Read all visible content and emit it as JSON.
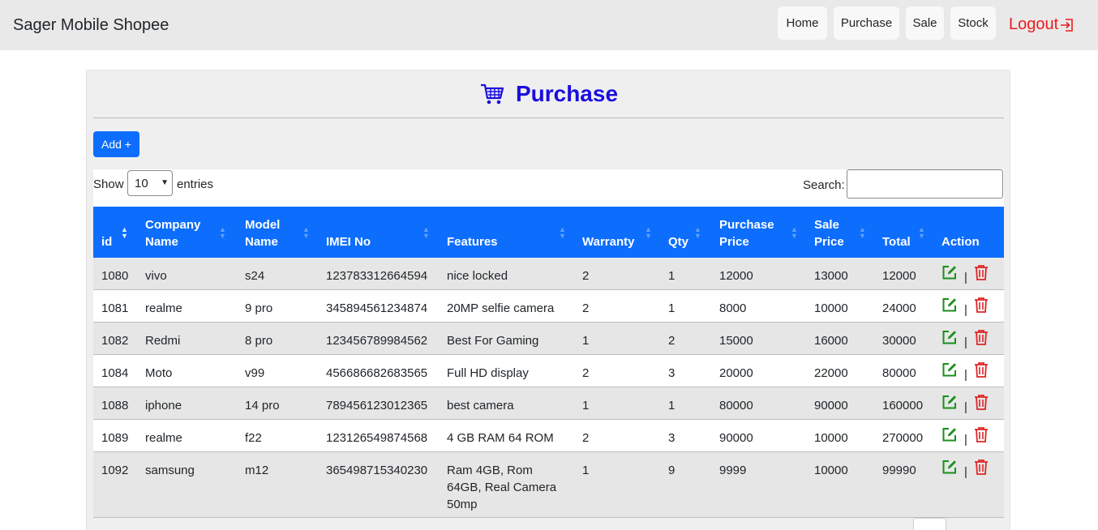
{
  "navbar": {
    "brand": "Sager Mobile Shopee",
    "links": [
      "Home",
      "Purchase",
      "Sale",
      "Stock"
    ],
    "logout": "Logout"
  },
  "page": {
    "title": "Purchase",
    "add_button": "Add +"
  },
  "controls": {
    "show_label": "Show",
    "entries_value": "10",
    "entries_label": "entries",
    "search_label": "Search:",
    "search_value": ""
  },
  "table": {
    "headers": [
      {
        "line1": "id",
        "line2": ""
      },
      {
        "line1": "Company",
        "line2": "Name"
      },
      {
        "line1": "Model",
        "line2": "Name"
      },
      {
        "line1": "IMEI No",
        "line2": ""
      },
      {
        "line1": "Features",
        "line2": ""
      },
      {
        "line1": "Warranty",
        "line2": ""
      },
      {
        "line1": "Qty",
        "line2": ""
      },
      {
        "line1": "Purchase",
        "line2": "Price"
      },
      {
        "line1": "Sale",
        "line2": "Price"
      },
      {
        "line1": "Total",
        "line2": ""
      },
      {
        "line1": "Action",
        "line2": ""
      }
    ],
    "rows": [
      [
        "1080",
        "vivo",
        "s24",
        "123783312664594",
        "nice locked",
        "2",
        "1",
        "12000",
        "13000",
        "12000"
      ],
      [
        "1081",
        "realme",
        "9 pro",
        "345894561234874",
        "20MP selfie camera",
        "2",
        "1",
        "8000",
        "10000",
        "24000"
      ],
      [
        "1082",
        "Redmi",
        "8 pro",
        "123456789984562",
        "Best For Gaming",
        "1",
        "2",
        "15000",
        "16000",
        "30000"
      ],
      [
        "1084",
        "Moto",
        "v99",
        "456686682683565",
        "Full HD display",
        "2",
        "3",
        "20000",
        "22000",
        "80000"
      ],
      [
        "1088",
        "iphone",
        "14 pro",
        "789456123012365",
        "best camera",
        "1",
        "1",
        "80000",
        "90000",
        "160000"
      ],
      [
        "1089",
        "realme",
        "f22",
        "123126549874568",
        "4 GB RAM 64 ROM",
        "2",
        "3",
        "90000",
        "10000",
        "270000"
      ],
      [
        "1092",
        "samsung",
        "m12",
        "365498715340230",
        "Ram 4GB, Rom\n64GB, Real Camera\n50mp",
        "1",
        "9",
        "9999",
        "10000",
        "99990"
      ]
    ],
    "action_separator": "|"
  },
  "colors": {
    "accent": "#0d6efd",
    "title": "#1a0dde",
    "logout": "#ec1c1c",
    "edit_icon": "#1a8f1a",
    "delete_icon": "#e02424"
  },
  "icons": {
    "cart": "shopping-cart-icon",
    "logout": "logout-icon",
    "edit": "edit-icon",
    "delete": "trash-icon"
  }
}
